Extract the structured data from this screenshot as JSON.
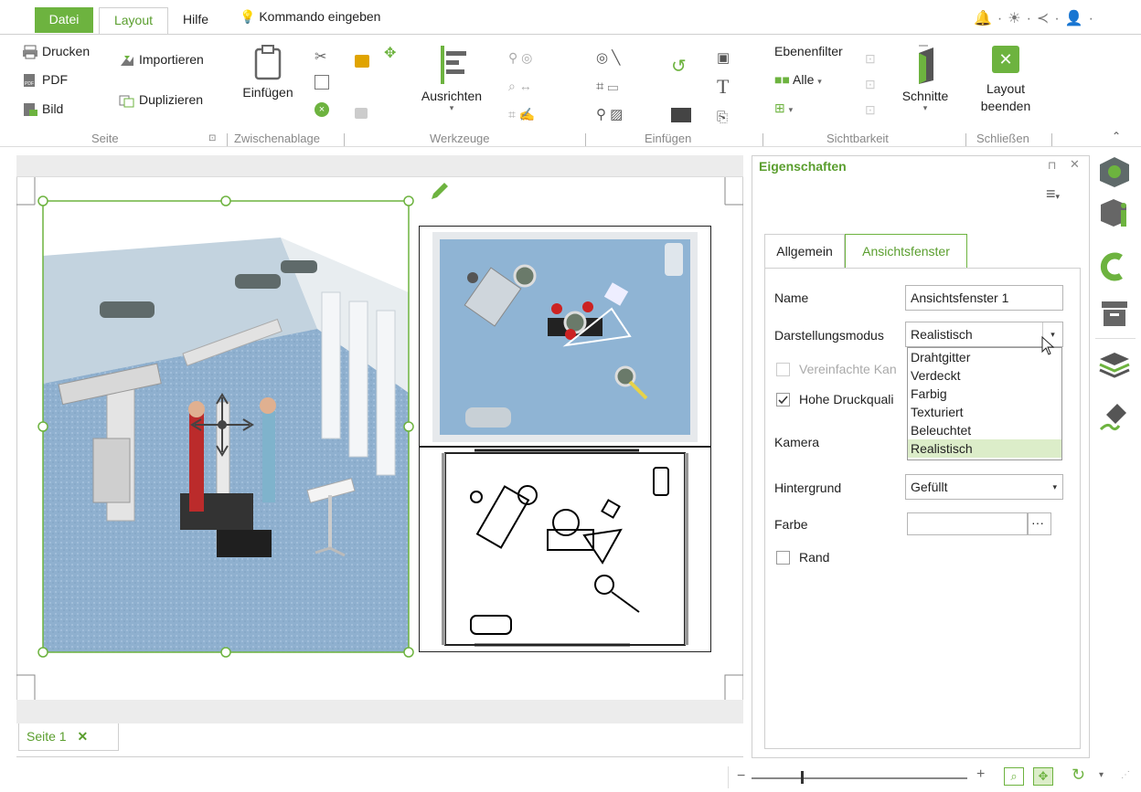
{
  "tabs": {
    "file": "Datei",
    "layout": "Layout",
    "help": "Hilfe",
    "command": "Kommando eingeben"
  },
  "ribbon": {
    "page": {
      "print": "Drucken",
      "pdf": "PDF",
      "image": "Bild",
      "group": "Seite"
    },
    "clipboard": {
      "import": "Importieren",
      "duplicate": "Duplizieren",
      "paste": "Einfügen",
      "group": "Zwischenablage"
    },
    "tools": {
      "align": "Ausrichten",
      "group": "Werkzeuge"
    },
    "insert": {
      "group": "Einfügen"
    },
    "visibility": {
      "layer_filter": "Ebenenfilter",
      "all": "Alle",
      "group": "Sichtbarkeit"
    },
    "sections": {
      "label": "Schnitte"
    },
    "close": {
      "end_line1": "Layout",
      "end_line2": "beenden",
      "group": "Schließen"
    }
  },
  "page_tab": {
    "label": "Seite 1"
  },
  "properties": {
    "title": "Eigenschaften",
    "tabs": [
      "Allgemein",
      "Ansichtsfenster"
    ],
    "name_label": "Name",
    "name_value": "Ansichtsfenster 1",
    "mode_label": "Darstellungsmodus",
    "mode_value": "Realistisch",
    "mode_options": [
      "Drahtgitter",
      "Verdeckt",
      "Farbig",
      "Texturiert",
      "Beleuchtet",
      "Realistisch"
    ],
    "simplified_label": "Vereinfachte Kan",
    "hq_label": "Hohe Druckquali",
    "camera_label": "Kamera",
    "background_label": "Hintergrund",
    "background_value": "Gefüllt",
    "color_label": "Farbe",
    "color_btn": "···",
    "border_label": "Rand"
  },
  "colors": {
    "accent": "#6db33f",
    "floor": "#8fb4d4",
    "selection": "#dcedc9"
  },
  "status": {
    "minus": "−",
    "plus": "+"
  }
}
